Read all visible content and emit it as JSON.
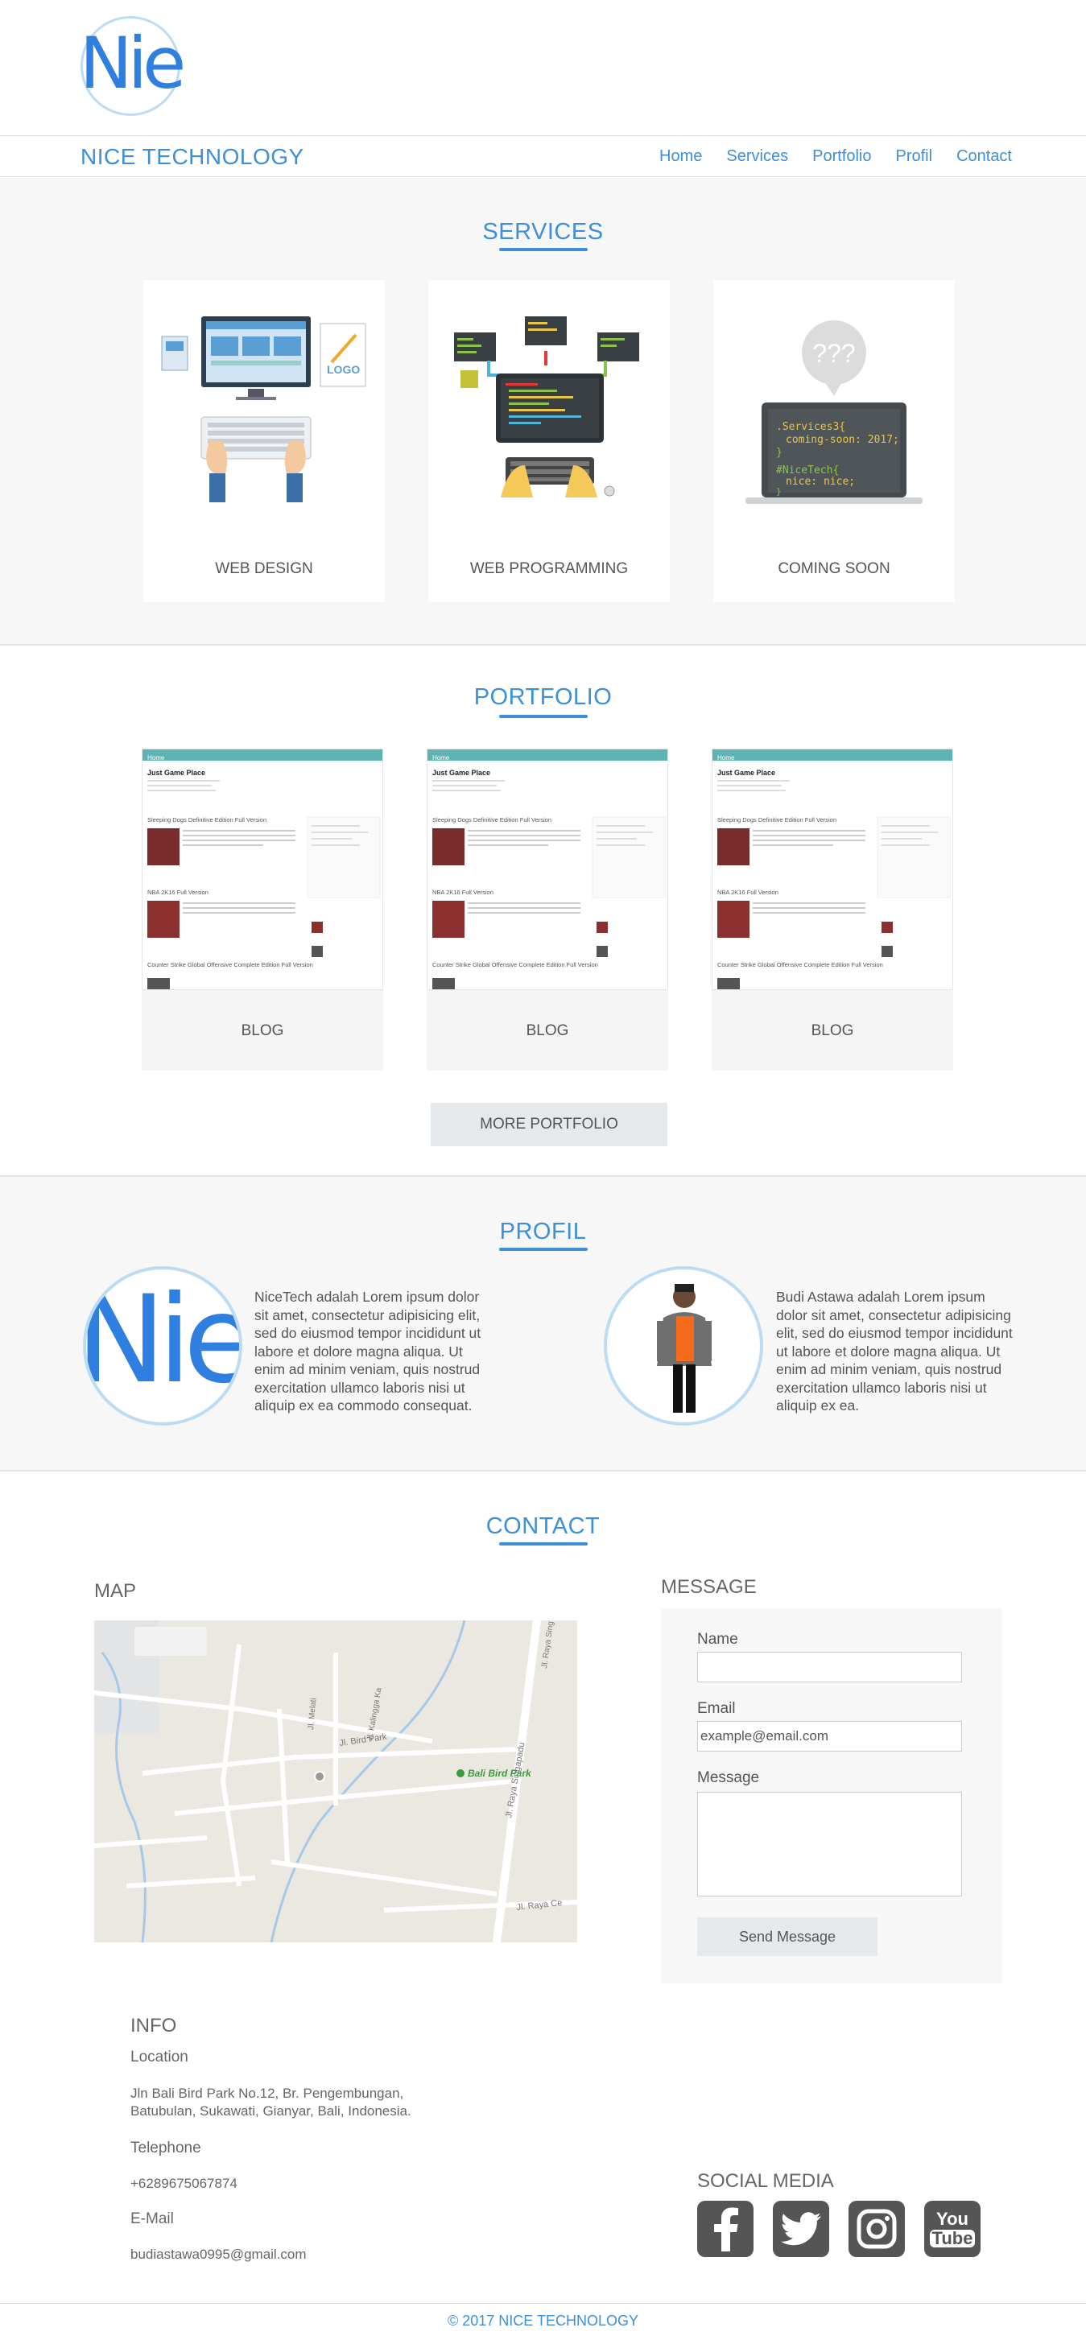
{
  "header": {
    "logo_text": "Nie",
    "brand": "NICE TECHNOLOGY",
    "nav": [
      "Home",
      "Services",
      "Portfolio",
      "Profil",
      "Contact"
    ]
  },
  "services": {
    "title": "SERVICES",
    "cards": [
      {
        "label": "WEB DESIGN",
        "logo_text": "LOGO"
      },
      {
        "label": "WEB PROGRAMMING"
      },
      {
        "label": "COMING SOON",
        "bubble": "???",
        "code": ".Services3{",
        "code2": "coming-soon: 2017;",
        "code3": "}",
        "code4": "#NiceTech{",
        "code5": "nice: nice;",
        "code6": "}"
      }
    ]
  },
  "portfolio": {
    "title": "PORTFOLIO",
    "thumb": {
      "nav_home": "Home",
      "site_title": "Just Game Place",
      "post1": "Sleeping Dogs Definitive Edition Full Version",
      "post2": "NBA 2K16 Full Version",
      "post3": "Counter Strike Global Offensive Complete Edition Full Version"
    },
    "cards": [
      {
        "label": "BLOG"
      },
      {
        "label": "BLOG"
      },
      {
        "label": "BLOG"
      }
    ],
    "more_button": "MORE PORTFOLIO"
  },
  "profil": {
    "title": "PROFIL",
    "nicetech_logo": "Nie",
    "nicetech_text": "NiceTech adalah Lorem ipsum dolor sit amet, consectetur adipisicing elit, sed do eiusmod tempor incididunt ut labore et dolore magna aliqua. Ut enim ad minim veniam, quis nostrud exercitation ullamco laboris nisi ut aliquip ex ea commodo consequat.",
    "budi_text": "Budi Astawa adalah Lorem ipsum dolor sit amet, consectetur adipisicing elit, sed do eiusmod tempor incididunt ut labore et dolore magna aliqua. Ut enim ad minim veniam, quis nostrud exercitation ullamco laboris nisi ut aliquip ex ea."
  },
  "contact": {
    "title": "CONTACT",
    "map_title": "MAP",
    "map_labels": {
      "road1": "Jl. Bird Park",
      "poi": "Bali Bird Park",
      "road2": "Jl. Raya Singapadu",
      "road3": "Jl. Raya Ce",
      "road4": "Jl. Kalingga Ka",
      "road5": "Jl. Melati",
      "road6": "Jl. Raya Sing"
    },
    "message_title": "MESSAGE",
    "name_label": "Name",
    "email_label": "Email",
    "email_placeholder": "example@email.com",
    "message_label": "Message",
    "send_button": "Send Message"
  },
  "info": {
    "title": "INFO",
    "location_label": "Location",
    "location_line1": "Jln Bali Bird Park No.12, Br. Pengembungan,",
    "location_line2": "Batubulan, Sukawati, Gianyar, Bali, Indonesia.",
    "telephone_label": "Telephone",
    "telephone": "+6289675067874",
    "email_label": "E-Mail",
    "email": "budiastawa0995@gmail.com"
  },
  "social": {
    "title": "SOCIAL MEDIA",
    "icons": [
      "facebook-icon",
      "twitter-icon",
      "instagram-icon",
      "youtube-icon"
    ],
    "youtube_text1": "You",
    "youtube_text2": "Tube"
  },
  "footer": {
    "text": "© 2017 NICE TECHNOLOGY"
  },
  "colors": {
    "accent": "#3d8fd9",
    "section_bg": "#f7f7f7",
    "button_bg": "#e6e9ec",
    "thumb_bar": "#5fb3b3"
  }
}
